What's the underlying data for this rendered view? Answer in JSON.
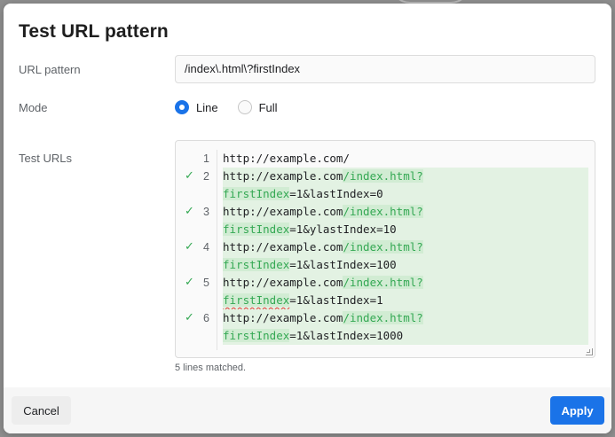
{
  "dialog": {
    "title": "Test URL pattern"
  },
  "fields": {
    "url_pattern_label": "URL pattern",
    "url_pattern_value": "/index\\.html\\?firstIndex",
    "mode_label": "Mode",
    "mode_options": [
      {
        "label": "Line",
        "checked": true
      },
      {
        "label": "Full",
        "checked": false
      }
    ],
    "test_urls_label": "Test URLs"
  },
  "editor": {
    "lines": [
      {
        "num": "1",
        "matched": false,
        "pre": "http://example.com/",
        "hl": "",
        "post": "",
        "wrap_hl": "",
        "wrap_post": ""
      },
      {
        "num": "2",
        "matched": true,
        "pre": "http://example.com",
        "hl": "/index.html?",
        "post": "",
        "wrap_hl": "firstIndex",
        "wrap_post": "=1&lastIndex=0"
      },
      {
        "num": "3",
        "matched": true,
        "pre": "http://example.com",
        "hl": "/index.html?",
        "post": "",
        "wrap_hl": "firstIndex",
        "wrap_post": "=1&ylastIndex=10"
      },
      {
        "num": "4",
        "matched": true,
        "pre": "http://example.com",
        "hl": "/index.html?",
        "post": "",
        "wrap_hl": "firstIndex",
        "wrap_post": "=1&lastIndex=100"
      },
      {
        "num": "5",
        "matched": true,
        "pre": "http://example.com",
        "hl": "/index.html?",
        "post": "",
        "wrap_hl": "firstIndex",
        "wrap_post": "=1&lastIndex=1"
      },
      {
        "num": "6",
        "matched": true,
        "pre": "http://example.com",
        "hl": "/index.html?",
        "post": "",
        "wrap_hl": "firstIndex",
        "wrap_post": "=1&lastIndex=1000"
      }
    ],
    "status": "5 lines matched."
  },
  "footer": {
    "cancel_label": "Cancel",
    "apply_label": "Apply"
  },
  "colors": {
    "accent": "#1a73e8",
    "match_green": "#34a853",
    "match_bg": "#e3f2e3"
  },
  "icons": {
    "match_check": "check-icon"
  }
}
